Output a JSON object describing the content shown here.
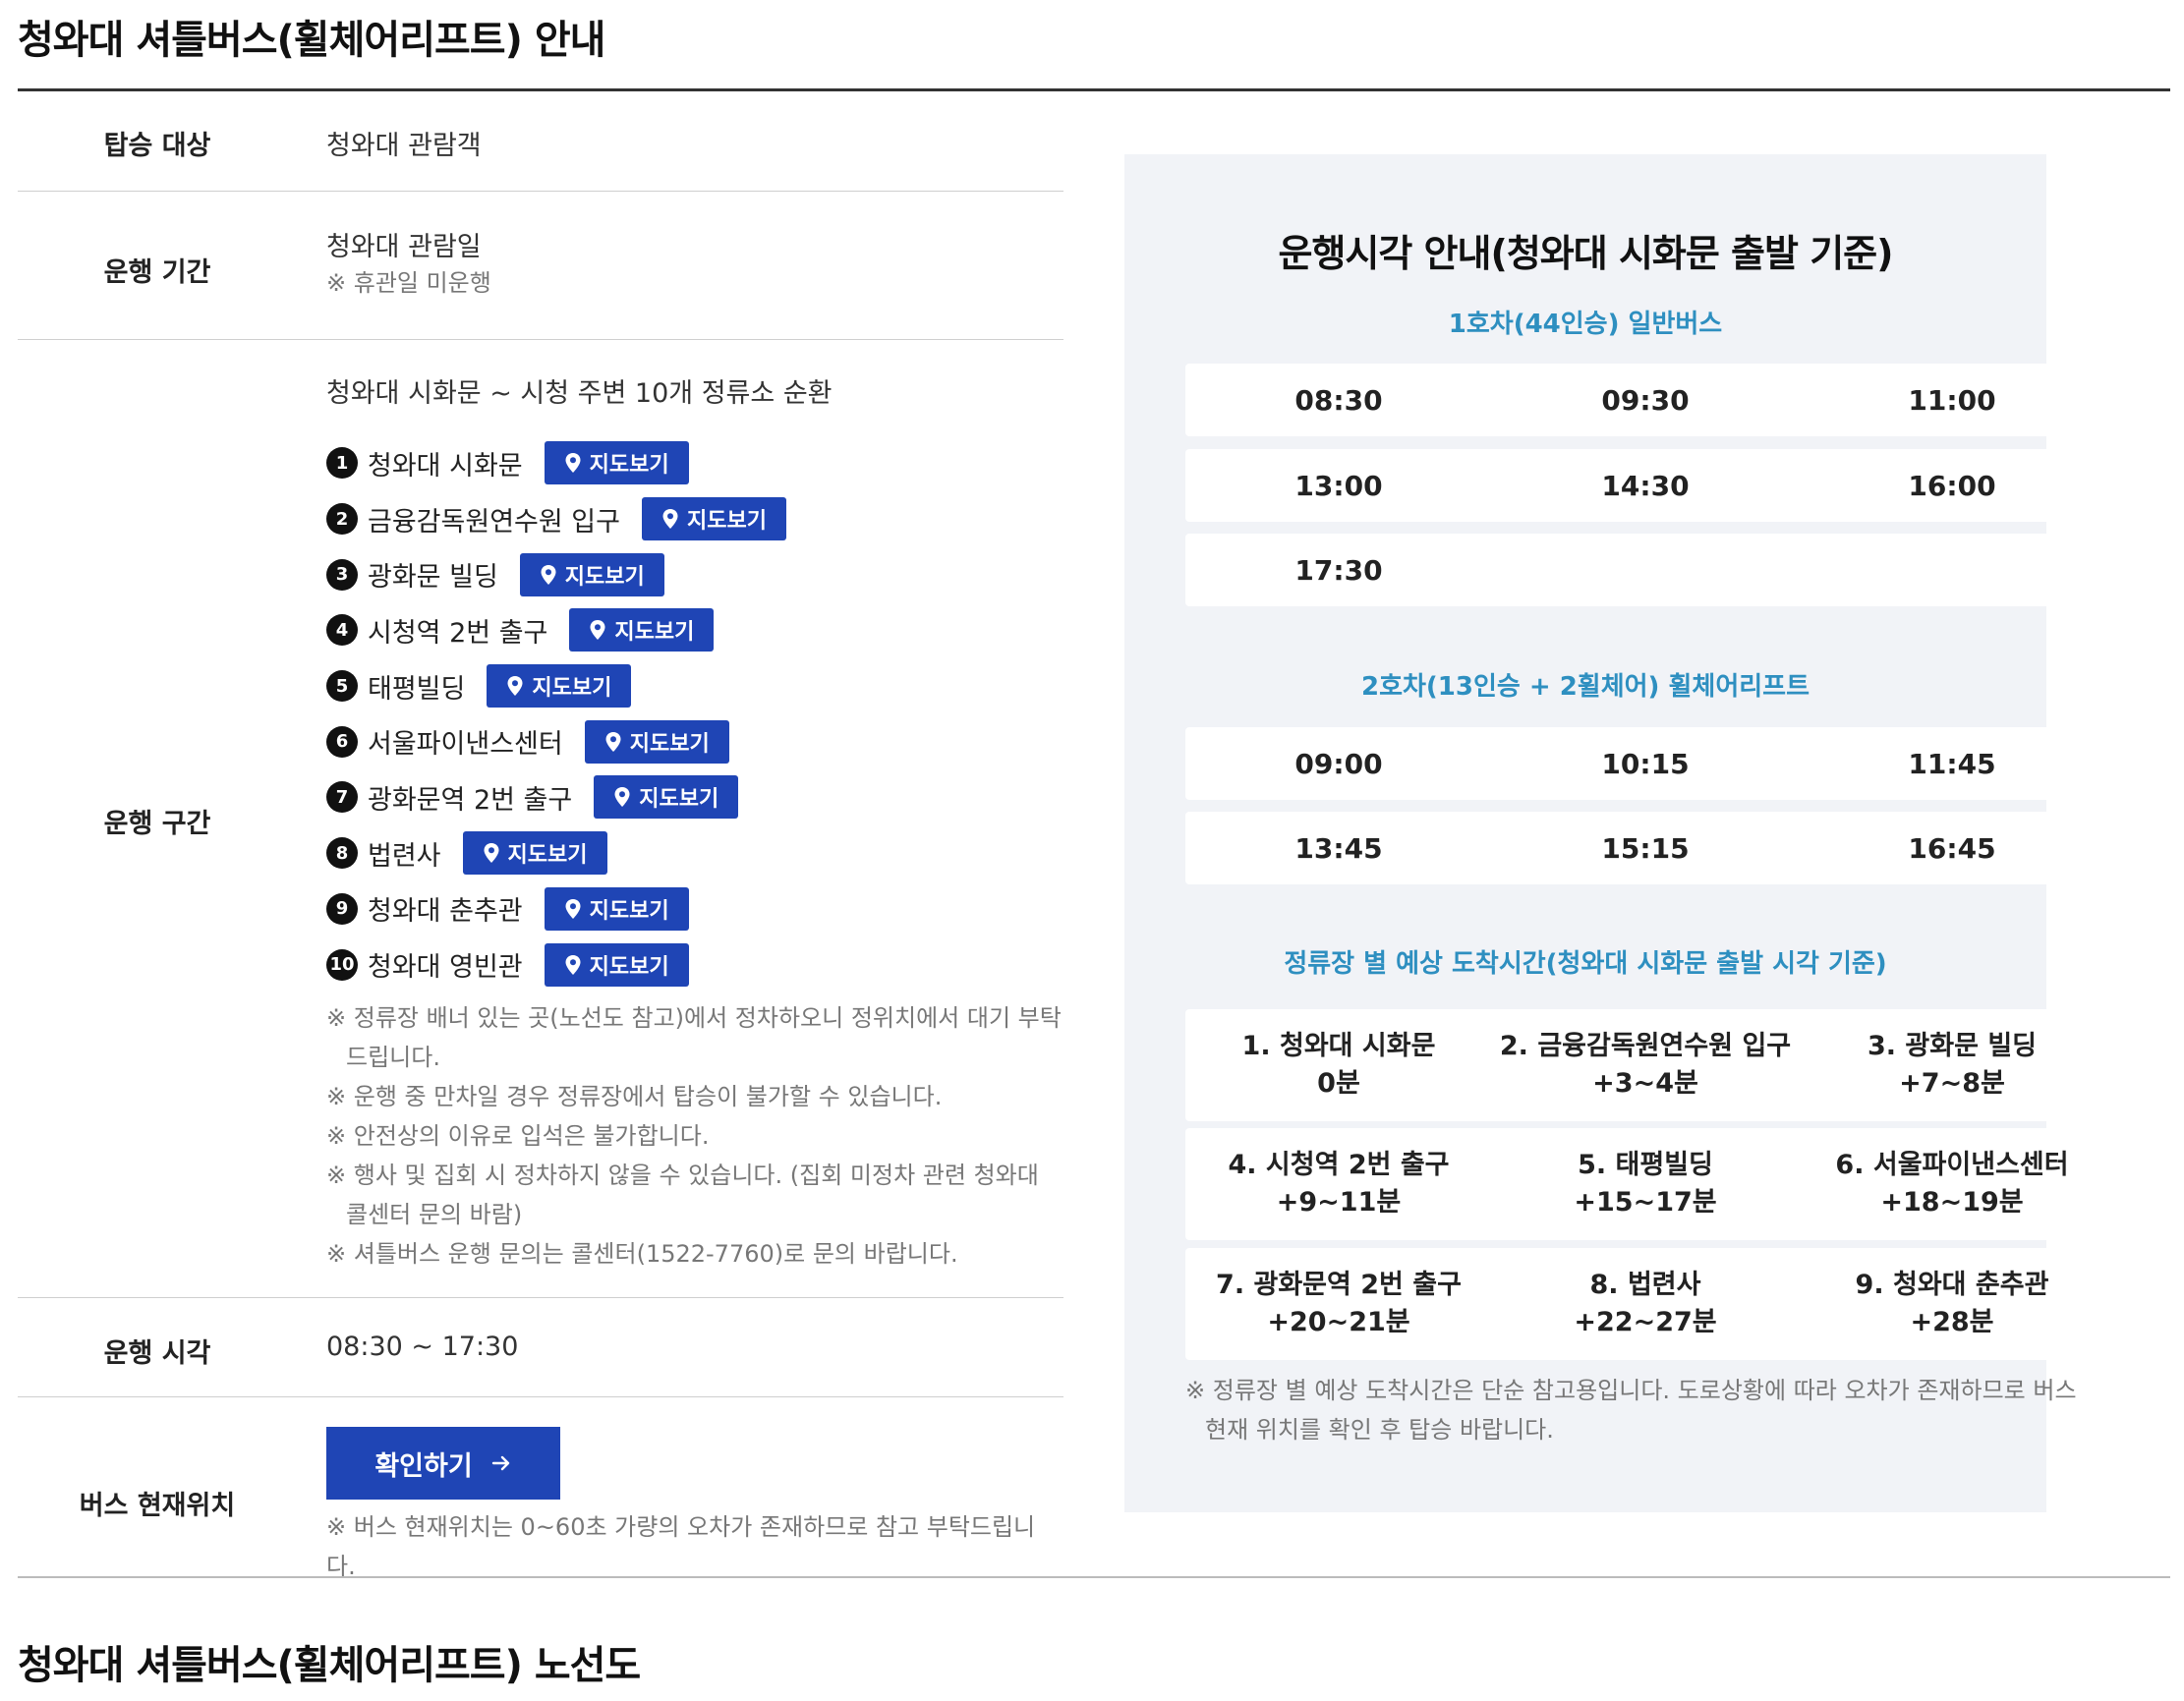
{
  "page_title": "청와대 셔틀버스(휠체어리프트) 안내",
  "info": {
    "target": {
      "label": "탑승 대상",
      "value": "청와대 관람객"
    },
    "period": {
      "label": "운행 기간",
      "value": "청와대 관람일",
      "note": "※ 휴관일 미운행"
    },
    "route": {
      "label": "운행 구간",
      "summary": "청와대 시화문 ~ 시청 주변 10개 정류소 순환",
      "map_button_label": "지도보기",
      "stops": [
        {
          "num": "1",
          "name": "청와대 시화문"
        },
        {
          "num": "2",
          "name": "금융감독원연수원 입구"
        },
        {
          "num": "3",
          "name": "광화문 빌딩"
        },
        {
          "num": "4",
          "name": "시청역 2번 출구"
        },
        {
          "num": "5",
          "name": "태평빌딩"
        },
        {
          "num": "6",
          "name": "서울파이낸스센터"
        },
        {
          "num": "7",
          "name": "광화문역 2번 출구"
        },
        {
          "num": "8",
          "name": "법련사"
        },
        {
          "num": "9",
          "name": "청와대 춘추관"
        },
        {
          "num": "10",
          "name": "청와대 영빈관"
        }
      ],
      "notes": [
        "※ 정류장 배너 있는 곳(노선도 참고)에서 정차하오니 정위치에서 대기 부탁드립니다.",
        "※ 운행 중 만차일 경우 정류장에서 탑승이 불가할 수 있습니다.",
        "※ 안전상의 이유로 입석은 불가합니다.",
        "※ 행사 및 집회 시 정차하지 않을 수 있습니다. (집회 미정차 관련 청와대 콜센터 문의 바람)",
        "※ 셔틀버스 운행 문의는 콜센터(1522-7760)로 문의 바랍니다."
      ]
    },
    "time": {
      "label": "운행 시각",
      "value": "08:30 ~ 17:30"
    },
    "bus_location": {
      "label": "버스 현재위치",
      "button_label": "확인하기",
      "note": "※ 버스 현재위치는 0~60초 가량의 오차가 존재하므로 참고 부탁드립니다."
    }
  },
  "schedule": {
    "title": "운행시각 안내(청와대 시화문 출발 기준)",
    "bus1": {
      "label": "1호차(44인승) 일반버스",
      "rows": [
        [
          "08:30",
          "09:30",
          "11:00"
        ],
        [
          "13:00",
          "14:30",
          "16:00"
        ],
        [
          "17:30",
          "",
          ""
        ]
      ]
    },
    "bus2": {
      "label": "2호차(13인승 + 2휠체어) 휠체어리프트",
      "rows": [
        [
          "09:00",
          "10:15",
          "11:45"
        ],
        [
          "13:45",
          "15:15",
          "16:45"
        ]
      ]
    },
    "arrival": {
      "label": "정류장 별 예상 도착시간(청와대 시화문 출발 시각 기준)",
      "rows": [
        [
          {
            "stop": "1. 청와대 시화문",
            "time": "0분"
          },
          {
            "stop": "2. 금융감독원연수원 입구",
            "time": "+3~4분"
          },
          {
            "stop": "3. 광화문 빌딩",
            "time": "+7~8분"
          }
        ],
        [
          {
            "stop": "4. 시청역 2번 출구",
            "time": "+9~11분"
          },
          {
            "stop": "5. 태평빌딩",
            "time": "+15~17분"
          },
          {
            "stop": "6. 서울파이낸스센터",
            "time": "+18~19분"
          }
        ],
        [
          {
            "stop": "7. 광화문역 2번 출구",
            "time": "+20~21분"
          },
          {
            "stop": "8. 법련사",
            "time": "+22~27분"
          },
          {
            "stop": "9. 청와대 춘추관",
            "time": "+28분"
          }
        ]
      ],
      "note": "※ 정류장 별 예상 도착시간은 단순 참고용입니다. 도로상황에 따라 오차가 존재하므로 버스 현재 위치를 확인 후 탑승 바랍니다."
    }
  },
  "route_map_title": "청와대 셔틀버스(휠체어리프트) 노선도",
  "colors": {
    "primary": "#1f45b5",
    "accent": "#2e8fc0",
    "panel_bg": "#f1f3f7"
  }
}
